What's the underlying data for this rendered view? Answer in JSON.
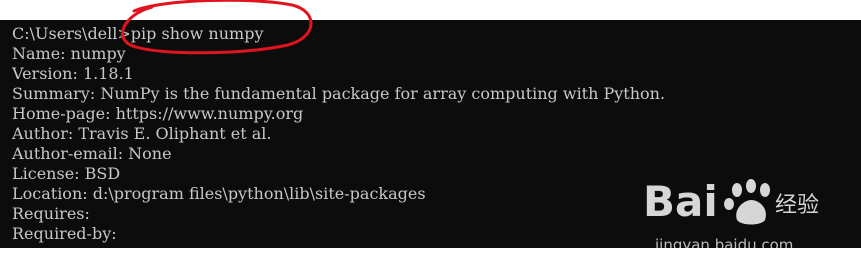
{
  "console": {
    "prompt": "C:\\Users\\dell>",
    "command": "pip show numpy",
    "output": [
      "Name: numpy",
      "Version: 1.18.1",
      "Summary: NumPy is the fundamental package for array computing with Python.",
      "Home-page: https://www.numpy.org",
      "Author: Travis E. Oliphant et al.",
      "Author-email: None",
      "License: BSD",
      "Location: d:\\program files\\python\\lib\\site-packages",
      "Requires:",
      "Required-by:"
    ]
  },
  "watermark": {
    "logo_text": "Bai经验",
    "url": "jingyan.baidu.com"
  },
  "colors": {
    "console_bg": "#0c0c0c",
    "console_text": "#c8c8c8",
    "annotation": "#e0141e"
  }
}
